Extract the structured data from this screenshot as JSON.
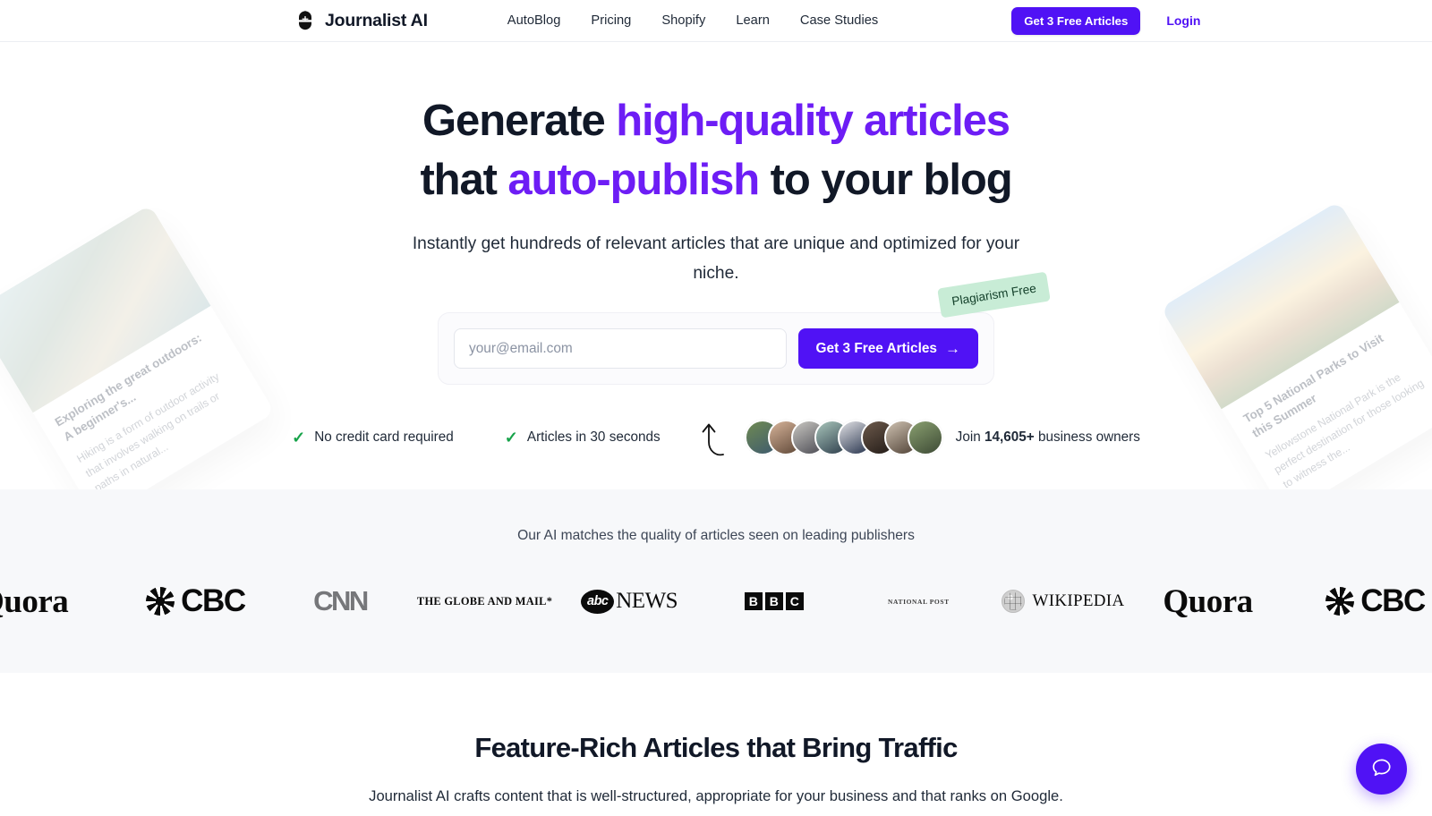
{
  "brand": {
    "name": "Journalist AI",
    "logo_icon": "journalist-ai-mark-icon"
  },
  "nav": {
    "links": [
      {
        "label": "AutoBlog"
      },
      {
        "label": "Pricing"
      },
      {
        "label": "Shopify"
      },
      {
        "label": "Learn"
      },
      {
        "label": "Case Studies"
      }
    ],
    "cta_label": "Get 3 Free Articles",
    "login_label": "Login"
  },
  "hero": {
    "headline_line1_plain": "Generate ",
    "headline_line1_accent": "high-quality articles",
    "headline_line2_pre": "that ",
    "headline_line2_accent": "auto-publish",
    "headline_line2_post": " to your blog",
    "subhead": "Instantly get hundreds of relevant articles that are unique and optimized for your niche.",
    "email_placeholder": "your@email.com",
    "email_value": "",
    "submit_label": "Get 3 Free Articles",
    "submit_arrow": "→",
    "badge_plagiarism": "Plagiarism Free",
    "trust": [
      {
        "icon": "check-icon",
        "label": "No credit card required"
      },
      {
        "icon": "check-icon",
        "label": "Articles in 30 seconds"
      }
    ],
    "social_proof": {
      "prefix": "Join ",
      "count": "14,605+",
      "suffix": " business owners",
      "avatar_count": 8
    },
    "cards": [
      {
        "title": "Exploring the great outdoors: A beginner's...",
        "desc": "Hiking is a form of outdoor activity that involves walking on trails or paths in natural..."
      },
      {
        "title": "Top 5 National Parks to Visit this Summer",
        "desc": "Yellowstone National Park is the perfect destination for those looking to witness the..."
      }
    ]
  },
  "publishers": {
    "title": "Our AI matches the quality of articles seen on leading publishers",
    "logos": [
      {
        "name": "Quora",
        "type": "quora"
      },
      {
        "name": "CBC",
        "type": "cbc"
      },
      {
        "name": "CNN",
        "type": "cnn"
      },
      {
        "name": "THE GLOBE AND MAIL*",
        "type": "globe"
      },
      {
        "name": "abc NEWS",
        "type": "abcnews",
        "oval": "abc",
        "word": "NEWS"
      },
      {
        "name": "BBC",
        "type": "bbc",
        "letters": [
          "B",
          "B",
          "C"
        ]
      },
      {
        "name": "NATIONAL POST",
        "type": "nationalpost"
      },
      {
        "name": "WIKIPEDIA",
        "type": "wikipedia",
        "word": "WIKIPEDIA"
      },
      {
        "name": "Quora",
        "type": "quora"
      },
      {
        "name": "CBC",
        "type": "cbc"
      }
    ]
  },
  "features": {
    "title": "Feature-Rich Articles that Bring Traffic",
    "subtitle": "Journalist AI crafts content that is well-structured, appropriate for your business and that ranks on Google."
  },
  "help": {
    "icon": "chat-bubble-icon",
    "label": "Help"
  },
  "colors": {
    "accent_purple": "#5012f5",
    "headline_accent": "#6d1df5",
    "check_green": "#17a34a",
    "badge_green_bg": "#c8ecd6",
    "publishers_bg": "#f7f8fa",
    "text_dark": "#111827"
  }
}
